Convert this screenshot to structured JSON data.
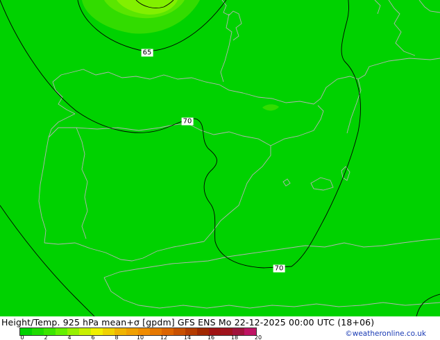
{
  "map": {
    "background_color": "#00d200",
    "higher_shade_colors": [
      "#32dc00",
      "#5ae600",
      "#82f000"
    ],
    "coastline_color": "#b4b4b4",
    "contour_color": "#000000",
    "contour_labels": [
      {
        "id": "c65",
        "text": "65"
      },
      {
        "id": "c70a",
        "text": "70"
      },
      {
        "id": "c70b",
        "text": "70"
      }
    ]
  },
  "title": "Height/Temp. 925 hPa mean+σ [gpdm] GFS ENS  Mo 22-12-2025 00:00 UTC (18+06)",
  "credit": "©weatheronline.co.uk",
  "legend": {
    "colors": [
      "#00d200",
      "#1edc00",
      "#3ce600",
      "#64f000",
      "#96f000",
      "#c8f000",
      "#f0f000",
      "#f0d200",
      "#f0b400",
      "#f0a000",
      "#f08c00",
      "#e67800",
      "#dc6400",
      "#c85000",
      "#b43c00",
      "#a02800",
      "#a01414",
      "#a0141e",
      "#a0143c",
      "#be1464"
    ],
    "tick_labels": [
      "0",
      "2",
      "4",
      "6",
      "8",
      "10",
      "12",
      "14",
      "16",
      "18",
      "20"
    ]
  }
}
